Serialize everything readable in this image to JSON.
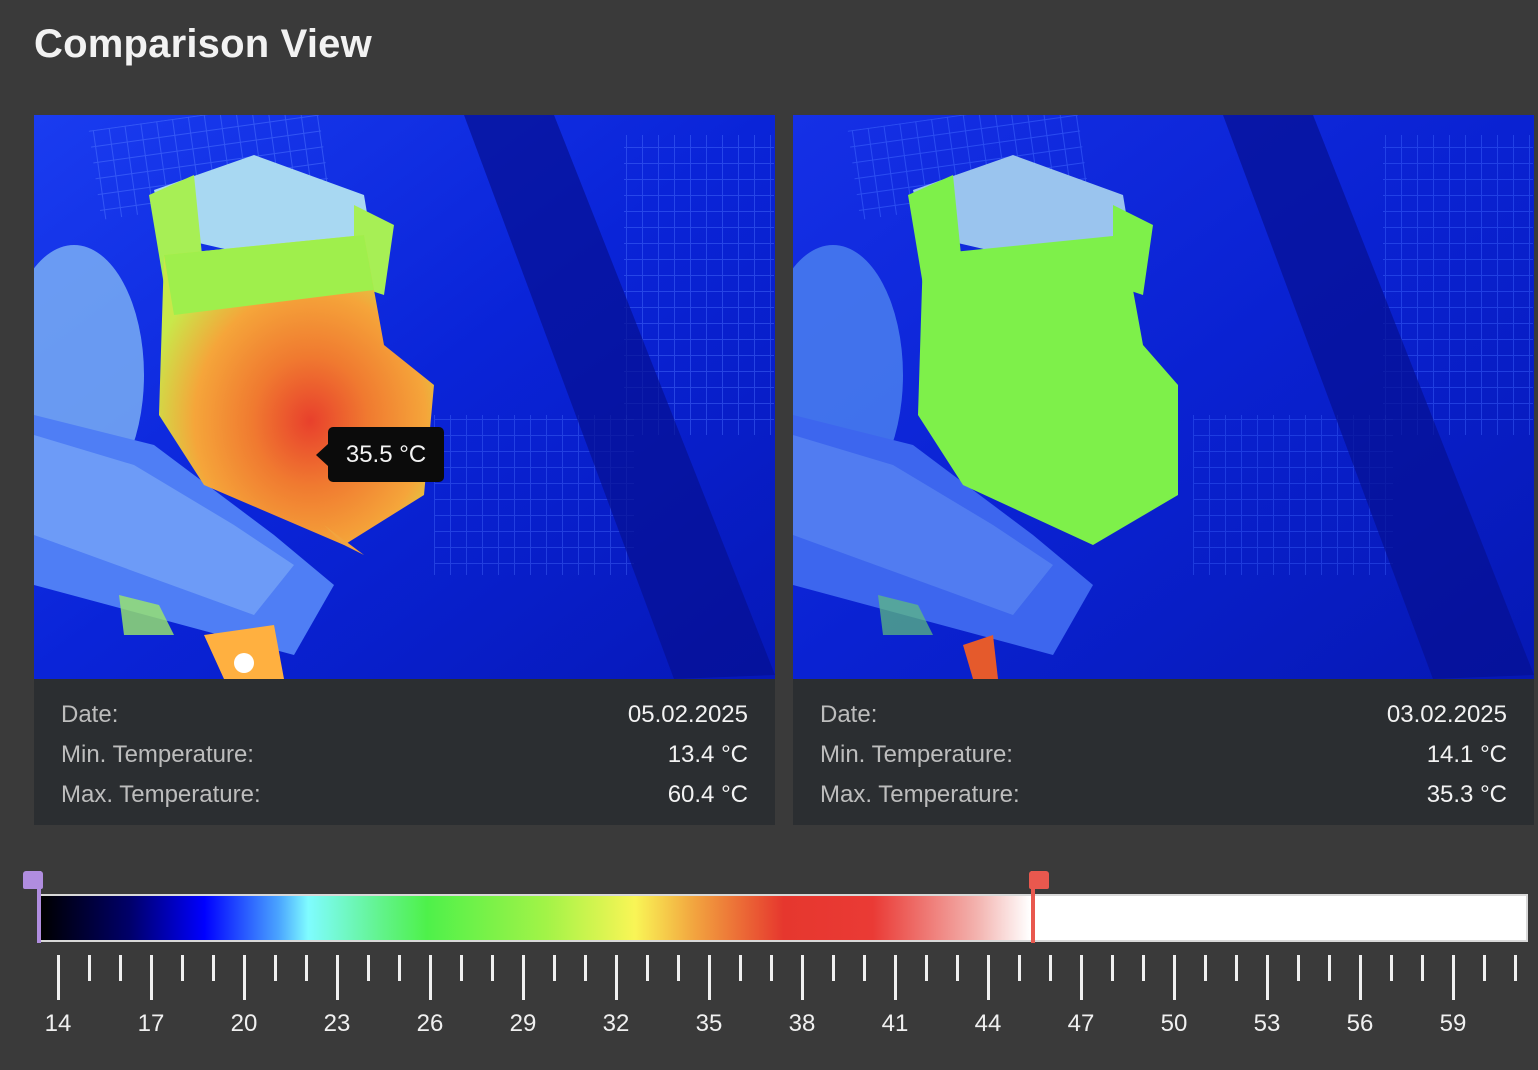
{
  "title": "Comparison View",
  "left_panel": {
    "tooltip": "35.5 °C",
    "date_label": "Date:",
    "date_value": "05.02.2025",
    "min_label": "Min. Temperature:",
    "min_value": "13.4 °C",
    "max_label": "Max. Temperature:",
    "max_value": "60.4 °C"
  },
  "right_panel": {
    "date_label": "Date:",
    "date_value": "03.02.2025",
    "min_label": "Min. Temperature:",
    "min_value": "14.1 °C",
    "max_label": "Max. Temperature:",
    "max_value": "35.3 °C"
  },
  "scale": {
    "min_temp": 14,
    "max_temp": 62,
    "range_low": 14,
    "range_high": 46,
    "tick_labels": [
      "14",
      "17",
      "20",
      "23",
      "26",
      "29",
      "32",
      "35",
      "38",
      "41",
      "44",
      "47",
      "50",
      "53",
      "56",
      "59"
    ],
    "colors": {
      "min_flag": "#b08ddf",
      "max_flag": "#e9584e"
    }
  }
}
